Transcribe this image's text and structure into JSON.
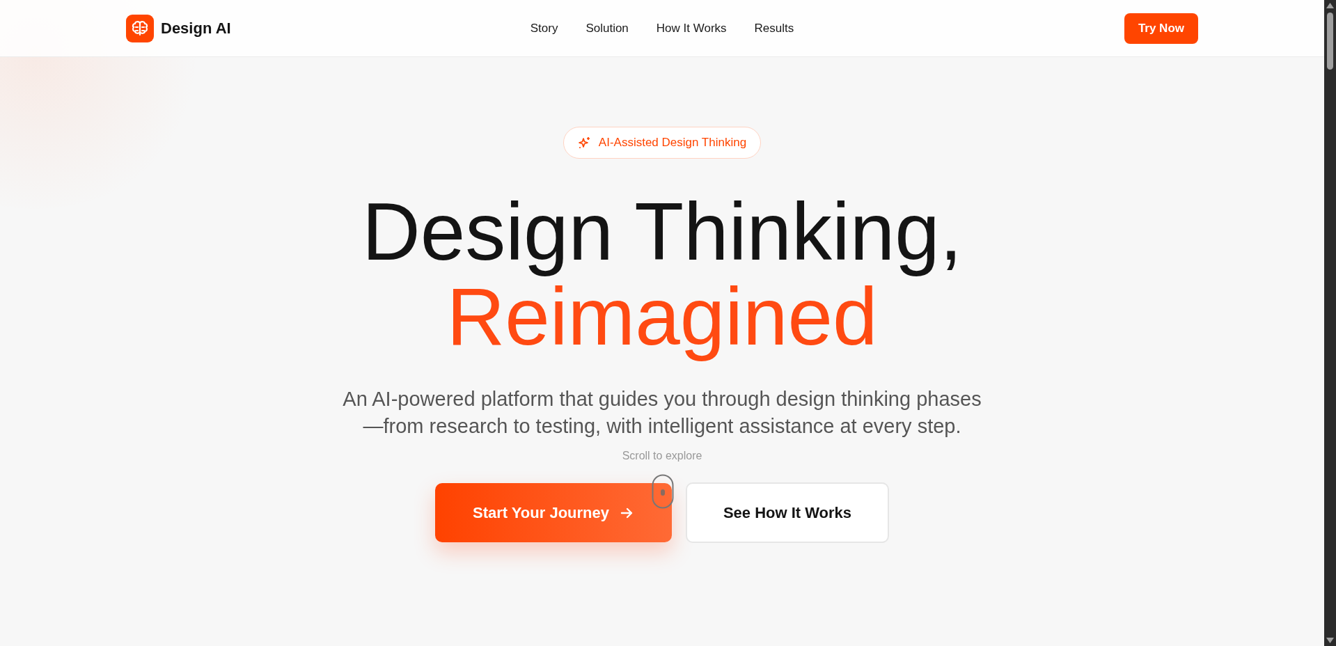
{
  "nav": {
    "brand": "Design AI",
    "links": [
      {
        "label": "Story"
      },
      {
        "label": "Solution"
      },
      {
        "label": "How It Works"
      },
      {
        "label": "Results"
      }
    ],
    "cta": "Try Now"
  },
  "hero": {
    "badge": "AI-Assisted Design Thinking",
    "title_line_1": "Design Thinking,",
    "title_line_2": "Reimagined",
    "subtitle": "An AI-powered platform that guides you through design thinking phases—from research to testing, with intelligent assistance at every step.",
    "scroll_hint": "Scroll to explore",
    "primary_button": "Start Your Journey",
    "secondary_button": "See How It Works"
  }
}
